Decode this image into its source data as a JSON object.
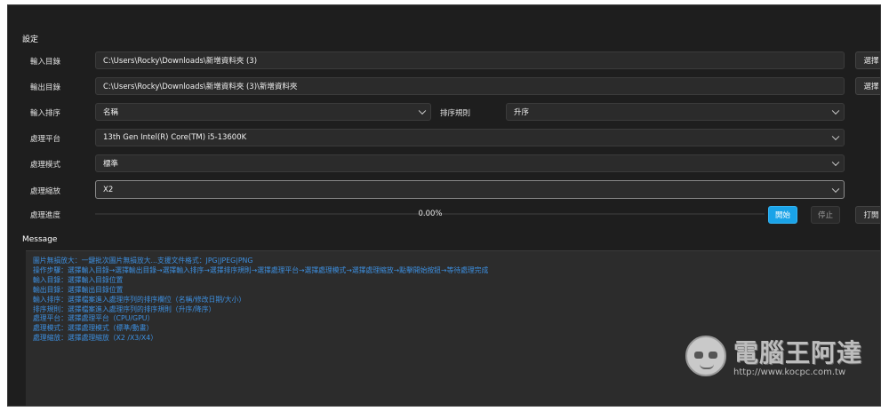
{
  "settings": {
    "title": "設定",
    "input_dir": {
      "label": "輸入目錄",
      "value": "C:\\Users\\Rocky\\Downloads\\新增資料夾 (3)",
      "browse": "選擇"
    },
    "output_dir": {
      "label": "輸出目錄",
      "value": "C:\\Users\\Rocky\\Downloads\\新增資料夾 (3)\\新增資料夾",
      "browse": "選擇"
    },
    "input_sort": {
      "label": "輸入排序",
      "value": "名稱",
      "rule_label": "排序規則",
      "rule_value": "升序"
    },
    "platform": {
      "label": "處理平台",
      "value": "13th Gen Intel(R) Core(TM) i5-13600K"
    },
    "mode": {
      "label": "處理模式",
      "value": "標準"
    },
    "scale": {
      "label": "處理縮放",
      "value": "X2"
    },
    "progress": {
      "label": "處理進度",
      "value_text": "0.00%",
      "fraction": 0.0
    },
    "buttons": {
      "start": "開始",
      "stop": "停止",
      "open": "打開"
    }
  },
  "message": {
    "title": "Message",
    "lines": [
      "圖片無損放大：一鍵批次圖片無損放大...支援文件格式：JPG|JPEG|PNG",
      "操作步驟：選擇輸入目錄→選擇輸出目錄→選擇輸入排序→選擇排序規則→選擇處理平台→選擇處理模式→選擇處理縮放→點擊開始按鈕→等待處理完成",
      "輸入目錄：選擇輸入目錄位置",
      "輸出目錄：選擇輸出目錄位置",
      "輸入排序：選擇檔案進入處理序列的排序欄位（名稱/修改日期/大小）",
      "排序規則：選擇檔案進入處理序列的排序規則（升序/降序）",
      "處理平台：選擇處理平台（CPU/GPU）",
      "處理模式：選擇處理模式（標準/動畫）",
      "處理縮放：選擇處理縮放（X2 /X3/X4）"
    ]
  },
  "watermark": {
    "title": "電腦王阿達",
    "url": "http://www.kocpc.com.tw"
  },
  "colors": {
    "accent": "#1aa3e8",
    "message_text": "#3d8fe0",
    "background": "#1e1e1e"
  }
}
